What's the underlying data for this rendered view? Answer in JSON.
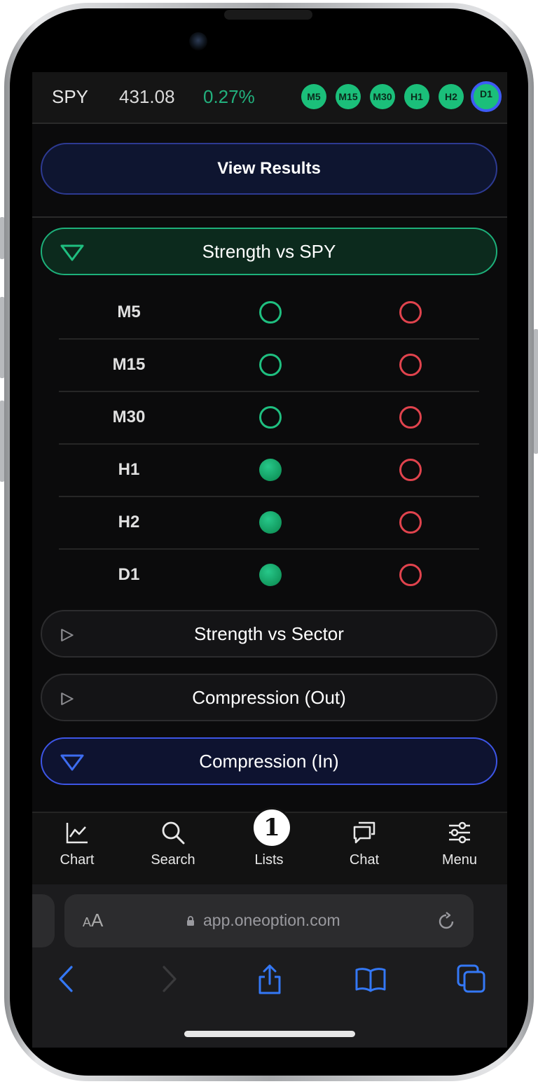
{
  "header": {
    "ticker": "SPY",
    "price": "431.08",
    "change": "0.27%",
    "timeframes": [
      "M5",
      "M15",
      "M30",
      "H1",
      "H2",
      "D1"
    ],
    "active_timeframe": "D1"
  },
  "view_results": "View Results",
  "sections": {
    "strength_spy": "Strength vs SPY",
    "strength_sector": "Strength vs Sector",
    "compression_out": "Compression (Out)",
    "compression_in": "Compression (In)"
  },
  "strength_rows": [
    {
      "label": "M5",
      "green": "outline",
      "red": "outline"
    },
    {
      "label": "M15",
      "green": "outline",
      "red": "outline"
    },
    {
      "label": "M30",
      "green": "outline",
      "red": "outline"
    },
    {
      "label": "H1",
      "green": "filled",
      "red": "outline"
    },
    {
      "label": "H2",
      "green": "filled",
      "red": "outline"
    },
    {
      "label": "D1",
      "green": "filled",
      "red": "outline"
    }
  ],
  "tabbar": {
    "chart": "Chart",
    "search": "Search",
    "lists": "Lists",
    "lists_logo": "1",
    "chat": "Chat",
    "menu": "Menu"
  },
  "safari": {
    "aa_small": "A",
    "aa_large": "A",
    "url": "app.oneoption.com"
  },
  "colors": {
    "accent_green": "#1fbf80",
    "accent_red": "#e0434d",
    "accent_blue": "#3d55e6"
  }
}
